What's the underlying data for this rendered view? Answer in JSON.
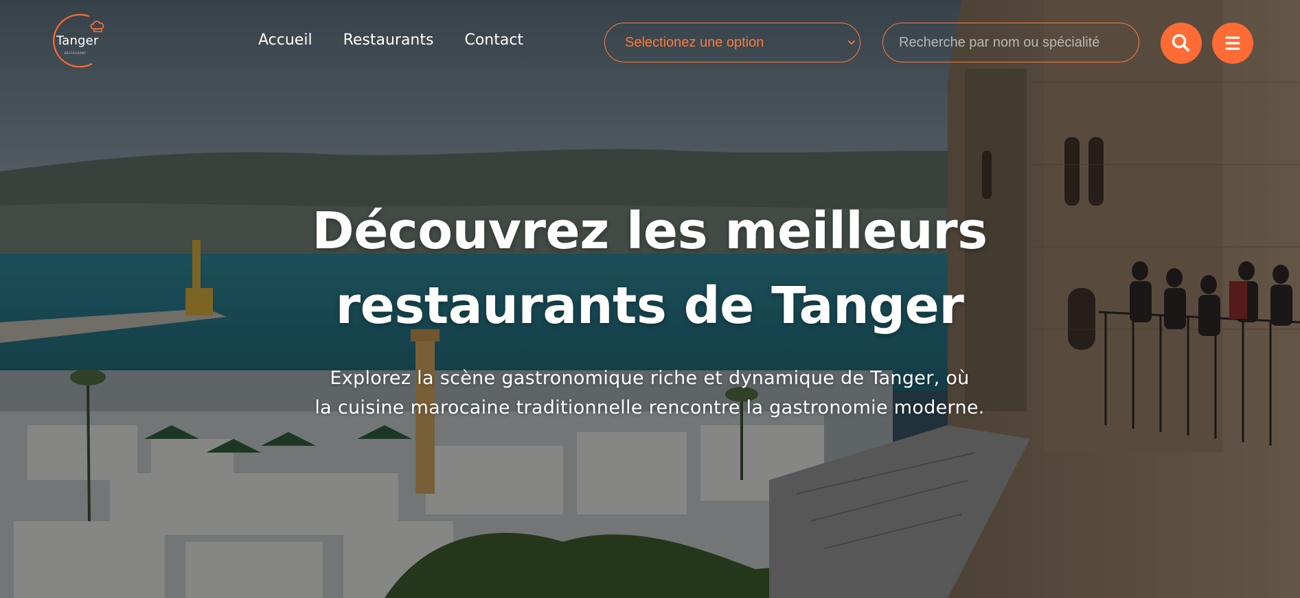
{
  "brand": {
    "name": "Tanger",
    "tagline": "RESTAURANT",
    "accent_color": "#ff6b35"
  },
  "nav": {
    "items": [
      {
        "label": "Accueil"
      },
      {
        "label": "Restaurants"
      },
      {
        "label": "Contact"
      }
    ]
  },
  "filter": {
    "selected": "Selectionez une option",
    "icon": "chevron-down-icon"
  },
  "search": {
    "placeholder": "Recherche par nom ou spécialité",
    "value": "",
    "button_icon": "search-icon"
  },
  "menu": {
    "icon": "hamburger-menu-icon"
  },
  "hero": {
    "title_line1": "Découvrez les meilleurs",
    "title_line2": "restaurants de Tanger",
    "subtitle_line1": "Explorez la scène gastronomique riche et dynamique de Tanger, où",
    "subtitle_line2": "la cuisine marocaine traditionnelle rencontre la gastronomie moderne.",
    "background": "Tangier city panorama with harbor, mosque, sea and hills, darkened overlay"
  }
}
